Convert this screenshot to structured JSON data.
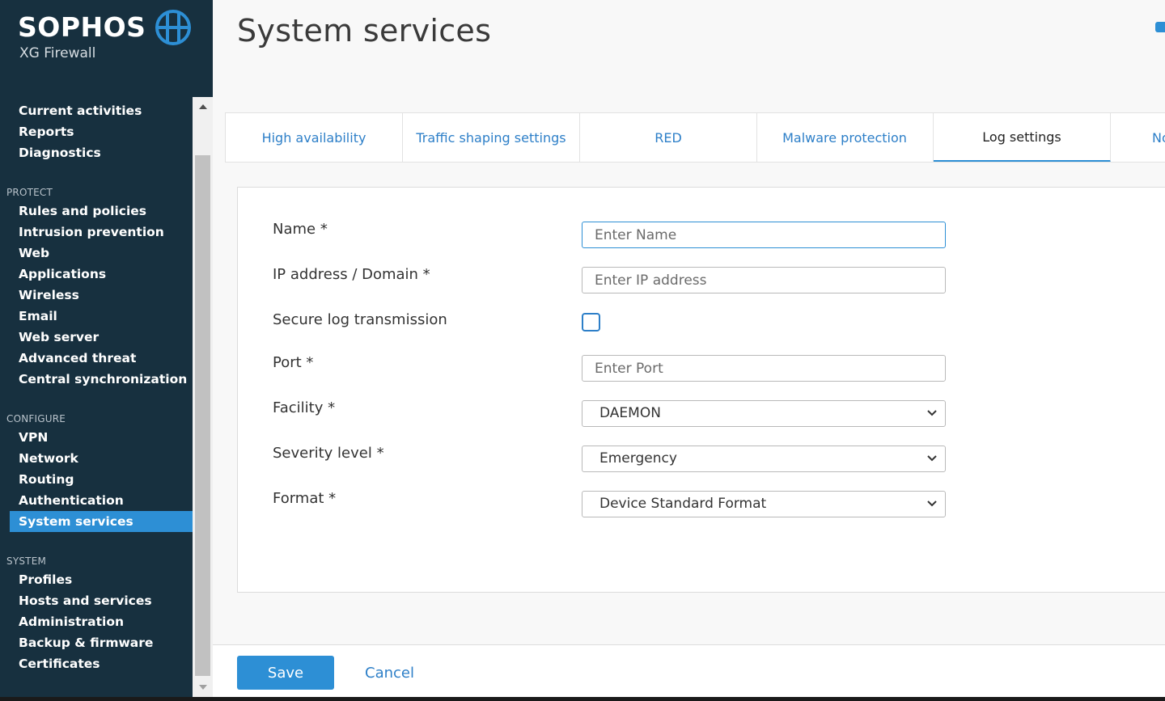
{
  "brand": {
    "name": "SOPHOS",
    "product": "XG Firewall"
  },
  "sidebar": {
    "monitor_items": [
      {
        "label": "Current activities"
      },
      {
        "label": "Reports"
      },
      {
        "label": "Diagnostics"
      }
    ],
    "protect_heading": "PROTECT",
    "protect_items": [
      {
        "label": "Rules and policies"
      },
      {
        "label": "Intrusion prevention"
      },
      {
        "label": "Web"
      },
      {
        "label": "Applications"
      },
      {
        "label": "Wireless"
      },
      {
        "label": "Email"
      },
      {
        "label": "Web server"
      },
      {
        "label": "Advanced threat"
      },
      {
        "label": "Central synchronization"
      }
    ],
    "configure_heading": "CONFIGURE",
    "configure_items": [
      {
        "label": "VPN"
      },
      {
        "label": "Network"
      },
      {
        "label": "Routing"
      },
      {
        "label": "Authentication"
      },
      {
        "label": "System services",
        "active": true
      }
    ],
    "system_heading": "SYSTEM",
    "system_items": [
      {
        "label": "Profiles"
      },
      {
        "label": "Hosts and services"
      },
      {
        "label": "Administration"
      },
      {
        "label": "Backup & firmware"
      },
      {
        "label": "Certificates"
      }
    ]
  },
  "page": {
    "title": "System services"
  },
  "tabs": [
    {
      "label": "High availability"
    },
    {
      "label": "Traffic shaping settings"
    },
    {
      "label": "RED"
    },
    {
      "label": "Malware protection"
    },
    {
      "label": "Log settings",
      "active": true
    },
    {
      "label": "No"
    }
  ],
  "form": {
    "name": {
      "label": "Name *",
      "placeholder": "Enter Name",
      "value": ""
    },
    "ip": {
      "label": "IP address / Domain *",
      "placeholder": "Enter IP address",
      "value": ""
    },
    "secure": {
      "label": "Secure log transmission",
      "checked": false
    },
    "port": {
      "label": "Port *",
      "placeholder": "Enter Port",
      "value": ""
    },
    "facility": {
      "label": "Facility *",
      "value": "DAEMON"
    },
    "severity": {
      "label": "Severity level *",
      "value": "Emergency"
    },
    "format": {
      "label": "Format *",
      "value": "Device Standard Format"
    }
  },
  "actions": {
    "save_label": "Save",
    "cancel_label": "Cancel"
  },
  "colors": {
    "sidebar_bg": "#17303f",
    "accent": "#2d8fd5",
    "link": "#2d7fc8"
  },
  "icons": {
    "logo": "sophos-globe-icon",
    "select": "chevron-down-icon",
    "scroll_up": "scroll-up-arrow-icon",
    "scroll_down": "scroll-down-arrow-icon"
  }
}
